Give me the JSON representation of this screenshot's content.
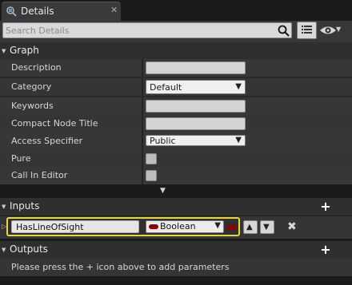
{
  "window": {
    "tab_title": "Details",
    "close_glyph": "✕"
  },
  "toolbar": {
    "search_placeholder": "Search Details"
  },
  "graph": {
    "title": "Graph",
    "properties": [
      {
        "label": "Description",
        "kind": "text",
        "value": ""
      },
      {
        "label": "Category",
        "kind": "combo",
        "value": "Default"
      },
      {
        "label": "Keywords",
        "kind": "text",
        "value": ""
      },
      {
        "label": "Compact Node Title",
        "kind": "text",
        "value": ""
      },
      {
        "label": "Access Specifier",
        "kind": "combo",
        "value": "Public"
      },
      {
        "label": "Pure",
        "kind": "checkbox",
        "checked": false
      },
      {
        "label": "Call In Editor",
        "kind": "checkbox",
        "checked": false
      }
    ]
  },
  "inputs": {
    "title": "Inputs",
    "params": [
      {
        "name": "HasLineOfSight",
        "type": "Boolean",
        "type_color": "#8f0000"
      }
    ]
  },
  "outputs": {
    "title": "Outputs",
    "message": "Please press the + icon above to add parameters"
  },
  "colors": {
    "highlight_border": "#e9d63a",
    "boolean_pin": "#8f0000",
    "panel_bg": "#373737",
    "header_bg": "#2f2f2f"
  },
  "icons": {
    "tab": "details-tab-icon",
    "search": "search-icon",
    "view_options": "list-view-icon",
    "visibility": "eye-icon",
    "add": "plus-icon",
    "move_up": "arrow-up-icon",
    "move_down": "arrow-down-icon",
    "remove": "close-icon"
  }
}
